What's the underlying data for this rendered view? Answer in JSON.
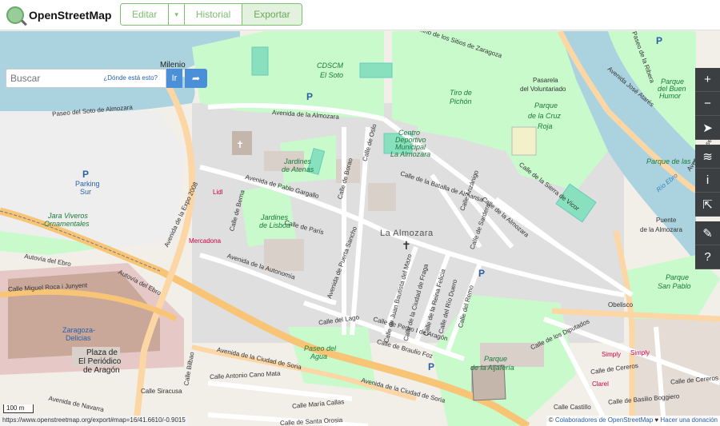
{
  "header": {
    "logo_text": "OpenStreetMap",
    "tabs": [
      {
        "label": "Editar"
      },
      {
        "label": "▾"
      },
      {
        "label": "Historial"
      },
      {
        "label": "Exportar"
      }
    ]
  },
  "search": {
    "placeholder": "Buscar",
    "where_label": "¿Dónde está esto?",
    "go_label": "Ir",
    "directions_icon": "directions-icon"
  },
  "controls": [
    {
      "icon": "zoom-in-icon",
      "glyph": "+"
    },
    {
      "icon": "zoom-out-icon",
      "glyph": "−"
    },
    {
      "icon": "locate-icon",
      "glyph": "➤"
    },
    {
      "icon": "layers-icon",
      "glyph": "≋"
    },
    {
      "icon": "info-icon",
      "glyph": "i"
    },
    {
      "icon": "share-icon",
      "glyph": "⇱"
    },
    {
      "icon": "note-icon",
      "glyph": "✎"
    },
    {
      "icon": "query-icon",
      "glyph": "?"
    }
  ],
  "map_labels": {
    "milenio": "Milenio",
    "paseo_soto": "Paseo del Soto de Almozara",
    "cdscm": "CDSCM",
    "el_soto": "El Soto",
    "la_almozara_big": "La Almozara",
    "tiro_pichon_1": "Tiro de",
    "tiro_pichon_2": "Pichón",
    "pasarela_1": "Pasarela",
    "pasarela_2": "del Voluntariado",
    "parque_cruz_1": "Parque",
    "parque_cruz_2": "de la Cruz",
    "parque_cruz_3": "Roja",
    "parque_buen_humor_1": "Parque",
    "parque_buen_humor_2": "del Buen",
    "parque_buen_humor_3": "Humor",
    "parque_ranillas": "Parque de las Ranillas",
    "rio_ebro": "Río Ebro",
    "puente_1": "Puente",
    "puente_2": "de la Almozara",
    "parque_san_pablo_1": "Parque",
    "parque_san_pablo_2": "San Pablo",
    "obelisco": "Obelisco",
    "centro_dep_1": "Centro",
    "centro_dep_2": "Deportivo",
    "centro_dep_3": "Municipal",
    "centro_dep_4": "La Almozara",
    "jardines_atenas_1": "Jardines",
    "jardines_atenas_2": "de Atenas",
    "jardines_lisboa_1": "Jardines",
    "jardines_lisboa_2": "de Lisboa",
    "parking_sur_1": "Parking",
    "parking_sur_2": "Sur",
    "jara_viveros_1": "Jara Viveros",
    "jara_viveros_2": "Ornamentales",
    "lidl": "Lidl",
    "mercadona": "Mercadona",
    "autovia_ebro_1": "Autovía del Ebro",
    "autovia_ebro_2": "Autovía del Ebro",
    "avenida_expo": "Avenida de la Expo 2008",
    "avenida_almozara": "Avenida de la Almozara",
    "avenida_pablo_gargallo": "Avenida de Pablo Gargallo",
    "avenida_autonomia": "Avenida de la Autonomía",
    "avenida_puerta_sancho": "Avenida de Puerta Sancho",
    "avenida_ciudad_soria": "Avenida de la Ciudad de Soria",
    "avenida_ciudad_soria_2": "Avenida de la Ciudad de Soria",
    "calle_batalla": "Calle de la Batalla de Almansa",
    "calle_sierra_vicor": "Calle de la Sierra de Vicor",
    "calle_lago": "Calle del Lago",
    "calle_paris": "Calle de París",
    "calle_berna": "Calle de Berna",
    "calle_borao": "Calle de Borao",
    "calle_oslo": "Calle de Oslo",
    "calle_bruselas": "Calle de Bruselas",
    "calle_sardera": "Calle de Sardera",
    "calle_ancelon": "Calle Anzánigo",
    "calle_almozara": "Calle de la Almozara",
    "calle_juan_mazo": "Calle de Juan Bautista del Mazo",
    "calle_ciudad_fraga": "Calle de la Ciudad de Fraga",
    "calle_ferrer_felicia": "Calle de la Reina Felicia",
    "calle_rio_duero": "Calle del Río Duero",
    "calle_remo": "Calle del Remo",
    "calle_pedro": "Calle de Pedro I de Aragón",
    "calle_braulio": "Calle de Braulio Foz",
    "calle_diputados": "Calle de los Diputados",
    "calle_cereros": "Calle de Cereros",
    "calle_cereros_2": "Calle de Cereros",
    "calle_basilio": "Calle de Basilio Boggiero",
    "calle_miguel_roca": "Calle Miguel Roca i Junyent",
    "calle_antonio_cano": "Calle Antonio Cano Mata",
    "calle_maria_callas": "Calle María Callas",
    "calle_santa_orosia": "Calle de Santa Orosia",
    "calle_siracusa": "Calle Siracusa",
    "calle_castillo": "Calle Castillo",
    "calle_bilbao": "Calle Bilbao",
    "avenida_navarra": "Avenida de Navarra",
    "avenida_jose_atares": "Avenida José Atarés",
    "avenida_jose_atares_2": "Avenida José Atarés",
    "paseo_ribera": "Paseo de la Ribera",
    "camino_sitios": "Camino de los Sitios de Zaragoza",
    "zaragoza_delicias_1": "Zaragoza-",
    "zaragoza_delicias_2": "Delicias",
    "plaza_periodico_1": "Plaza de",
    "plaza_periodico_2": "El Periódico",
    "plaza_periodico_3": "de Aragón",
    "paseo_agua_1": "Paseo del",
    "paseo_agua_2": "Agua",
    "parque_aljaferia_1": "Parque",
    "parque_aljaferia_2": "de la Aljafería",
    "simply": "Simply",
    "simply_2": "Simply",
    "clarel": "Clarel"
  },
  "scale_label": "100 m",
  "footer": {
    "url": "https://www.openstreetmap.org/export#map=16/41.6610/-0.9015",
    "attrib_prefix": "© ",
    "attrib_link": "Colaboradores de OpenStreetMap",
    "attrib_sep": " ♥ ",
    "donate_link": "Hacer una donación"
  },
  "colors": {
    "water": "#aad3df",
    "park": "#c8facc",
    "pitch": "#88e0be",
    "motorway": "#f8c576",
    "primary": "#fcd6a4",
    "rail": "#bbb"
  }
}
